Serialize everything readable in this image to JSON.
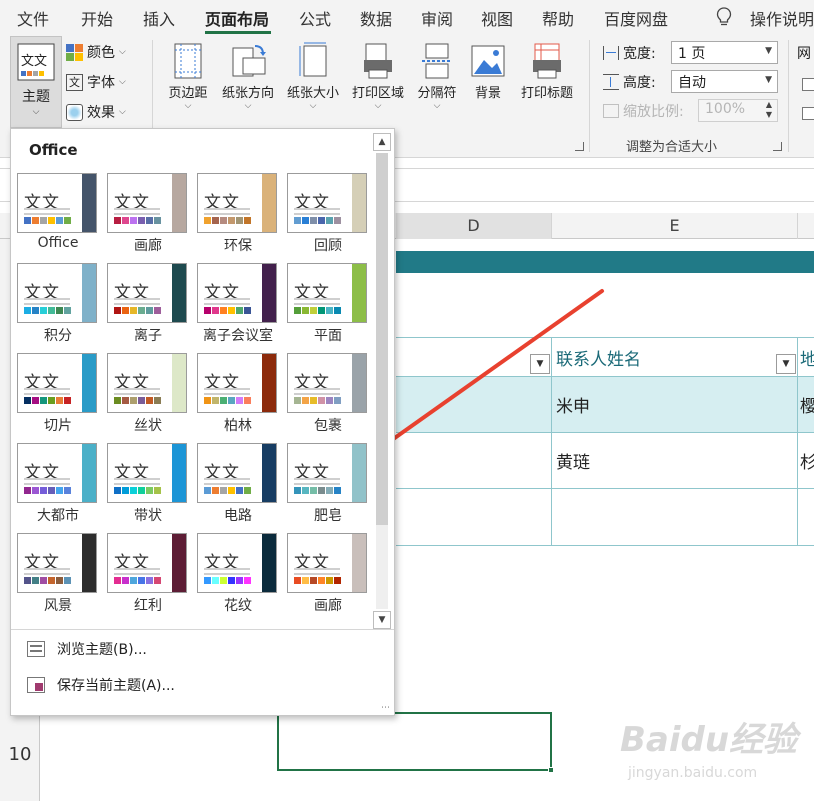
{
  "tabs": [
    "文件",
    "开始",
    "插入",
    "页面布局",
    "公式",
    "数据",
    "审阅",
    "视图",
    "帮助",
    "百度网盘",
    "操作说明"
  ],
  "active_tab": "页面布局",
  "ribbon": {
    "theme_label": "主题",
    "colors_label": "颜色",
    "fonts_label": "字体",
    "effects_label": "效果",
    "margins_label": "页边距",
    "orientation_label": "纸张方向",
    "size_label": "纸张大小",
    "print_area_label": "打印区域",
    "breaks_label": "分隔符",
    "background_label": "背景",
    "print_titles_label": "打印标题",
    "width_label": "宽度:",
    "width_value": "1 页",
    "height_label": "高度:",
    "height_value": "自动",
    "scale_label": "缩放比例:",
    "scale_value": "100%",
    "scale_group_label": "调整为合适大小",
    "gridlines_label": "网"
  },
  "sheet": {
    "col_d": "D",
    "col_e": "E",
    "row_10": "10",
    "header_contact": "联系人姓名",
    "header_next": "地",
    "row1_contact": "米申",
    "row1_next": "樱",
    "row2_contact": "黄琏",
    "row2_next": "杉"
  },
  "panel": {
    "title": "Office",
    "themes": [
      {
        "name": "Office",
        "accent": "#44546a",
        "swatches": [
          "#4472c4",
          "#ed7d31",
          "#a5a5a5",
          "#ffc000",
          "#5b9bd5",
          "#70ad47"
        ]
      },
      {
        "name": "画廊",
        "accent": "#b7a8a0",
        "swatches": [
          "#b71e42",
          "#de478e",
          "#bc72f0",
          "#795faf",
          "#586ea6",
          "#6892a0"
        ]
      },
      {
        "name": "环保",
        "accent": "#dab27a",
        "swatches": [
          "#f0a22e",
          "#a5644e",
          "#b58b80",
          "#c3986d",
          "#a19574",
          "#c17529"
        ]
      },
      {
        "name": "回顾",
        "accent": "#d5cfb7",
        "swatches": [
          "#629dd1",
          "#297fd5",
          "#7f8fa9",
          "#4a66ac",
          "#5aa2ae",
          "#9d90a0"
        ]
      },
      {
        "name": "积分",
        "accent": "#7fb1c9",
        "swatches": [
          "#1cade4",
          "#2683c6",
          "#27ced7",
          "#42ba97",
          "#3e8853",
          "#62a39f"
        ]
      },
      {
        "name": "离子",
        "accent": "#1e4a4f",
        "swatches": [
          "#b01513",
          "#ea6312",
          "#e6b729",
          "#6aac90",
          "#5f9c9d",
          "#9e5e9b"
        ]
      },
      {
        "name": "离子会议室",
        "accent": "#42204c",
        "swatches": [
          "#b6006c",
          "#e0388c",
          "#ff8021",
          "#ffc000",
          "#4fa76d",
          "#3a5596"
        ]
      },
      {
        "name": "平面",
        "accent": "#8dbe48",
        "swatches": [
          "#549e39",
          "#8ab833",
          "#c0cf3a",
          "#029676",
          "#4ab5c4",
          "#0989b1"
        ]
      },
      {
        "name": "切片",
        "accent": "#2a9bc7",
        "swatches": [
          "#052f61",
          "#a50e82",
          "#14967c",
          "#6a9e1f",
          "#e87d37",
          "#c62324"
        ]
      },
      {
        "name": "丝状",
        "accent": "#dde8c8",
        "swatches": [
          "#6b8c21",
          "#a55a43",
          "#ad9f6e",
          "#7a5c98",
          "#c15a25",
          "#8a7c54"
        ]
      },
      {
        "name": "柏林",
        "accent": "#8c2a0b",
        "swatches": [
          "#f09415",
          "#c1b56b",
          "#4baf73",
          "#5aa6c0",
          "#d17df9",
          "#fa7e5c"
        ]
      },
      {
        "name": "包裹",
        "accent": "#9aa3a9",
        "swatches": [
          "#a5b592",
          "#f3a447",
          "#e7bc29",
          "#d092a7",
          "#9c85c0",
          "#809ec2"
        ]
      },
      {
        "name": "大都市",
        "accent": "#4bb0c8",
        "swatches": [
          "#92278f",
          "#9b57d3",
          "#755dd9",
          "#665eb8",
          "#45a5ed",
          "#5982db"
        ]
      },
      {
        "name": "带状",
        "accent": "#1c95d6",
        "swatches": [
          "#0f6fc6",
          "#009dd9",
          "#0bd0d9",
          "#10cf9b",
          "#7cca62",
          "#a5c249"
        ]
      },
      {
        "name": "电路",
        "accent": "#173d63",
        "swatches": [
          "#5b9bd5",
          "#ed7d31",
          "#a5a5a5",
          "#ffc000",
          "#4472c4",
          "#70ad47"
        ]
      },
      {
        "name": "肥皂",
        "accent": "#91c2c9",
        "swatches": [
          "#3494ba",
          "#58b6c0",
          "#75bda7",
          "#7a8c8e",
          "#84acb6",
          "#2683c6"
        ]
      },
      {
        "name": "风景",
        "accent": "#2d2d2d",
        "swatches": [
          "#53548a",
          "#438086",
          "#a04da3",
          "#c4652d",
          "#8b5d3d",
          "#5c92b5"
        ]
      },
      {
        "name": "红利",
        "accent": "#5d1d35",
        "swatches": [
          "#e32d91",
          "#c830cc",
          "#4ea6dc",
          "#4775e7",
          "#8971e1",
          "#d54773"
        ]
      },
      {
        "name": "花纹",
        "accent": "#0b2b3c",
        "swatches": [
          "#3399ff",
          "#69ffff",
          "#ccff33",
          "#3333ff",
          "#9933ff",
          "#ff33ff"
        ]
      },
      {
        "name": "画廊",
        "accent": "#c9bfbb",
        "swatches": [
          "#e84c22",
          "#ffbd47",
          "#b64926",
          "#ff8427",
          "#cc9900",
          "#b22600"
        ]
      }
    ],
    "browse_label": "浏览主题(B)...",
    "save_label": "保存当前主题(A)..."
  },
  "watermark": {
    "brand": "Baidu经验",
    "url": "jingyan.baidu.com"
  },
  "colors": {
    "accent": "#217346",
    "teal": "#217a87",
    "arrow": "#e8412f"
  }
}
